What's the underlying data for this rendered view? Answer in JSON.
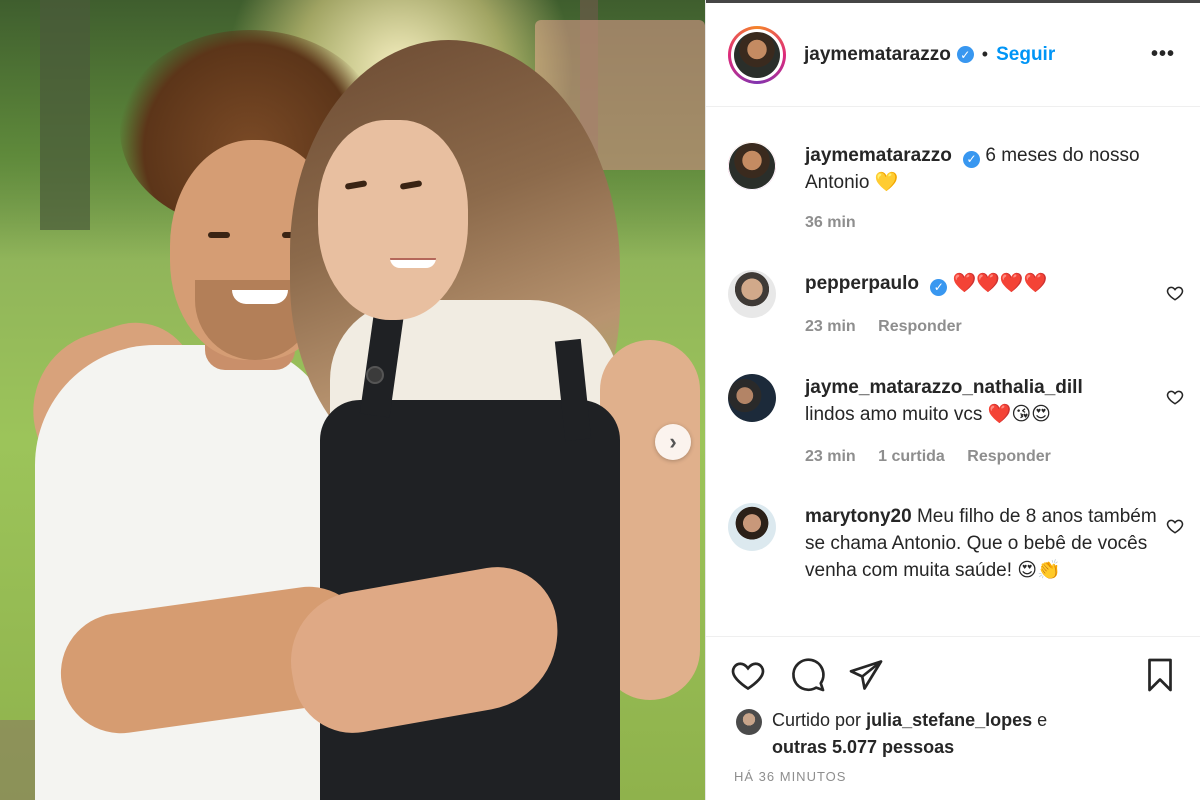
{
  "post": {
    "username": "jaymematarazzo",
    "separator": "•",
    "follow_label": "Seguir",
    "more_label": "•••",
    "verified_glyph": "✓",
    "carousel_next_glyph": "›"
  },
  "caption": {
    "username": "jaymematarazzo",
    "text": "6 meses do nosso Antonio 💛",
    "time": "36 min"
  },
  "comments": [
    {
      "username": "pepperpaulo",
      "verified": true,
      "text": "❤️❤️❤️❤️",
      "time": "23 min",
      "likes": "",
      "reply_label": "Responder"
    },
    {
      "username": "jayme_matarazzo_nathalia_dill",
      "verified": false,
      "text": "lindos amo muito vcs ❤️😘😍",
      "time": "23 min",
      "likes": "1 curtida",
      "reply_label": "Responder"
    },
    {
      "username": "marytony20",
      "verified": false,
      "text": "Meu filho de 8 anos também se chama Antonio. Que o bebê de vocês venha com muita saúde! 😍👏"
    }
  ],
  "likes": {
    "prefix": "Curtido por",
    "user": "julia_stefane_lopes",
    "conjunction": "e",
    "others": "outras 5.077 pessoas"
  },
  "timestamp": "HÁ 36 MINUTOS",
  "icons": [
    "heart-icon",
    "comment-icon",
    "share-icon",
    "bookmark-icon",
    "verified-icon",
    "more-icon",
    "chevron-right-icon"
  ],
  "colors": {
    "link": "#0095f6",
    "verified": "#3897f0",
    "meta": "#8e8e8e",
    "text": "#262626"
  }
}
